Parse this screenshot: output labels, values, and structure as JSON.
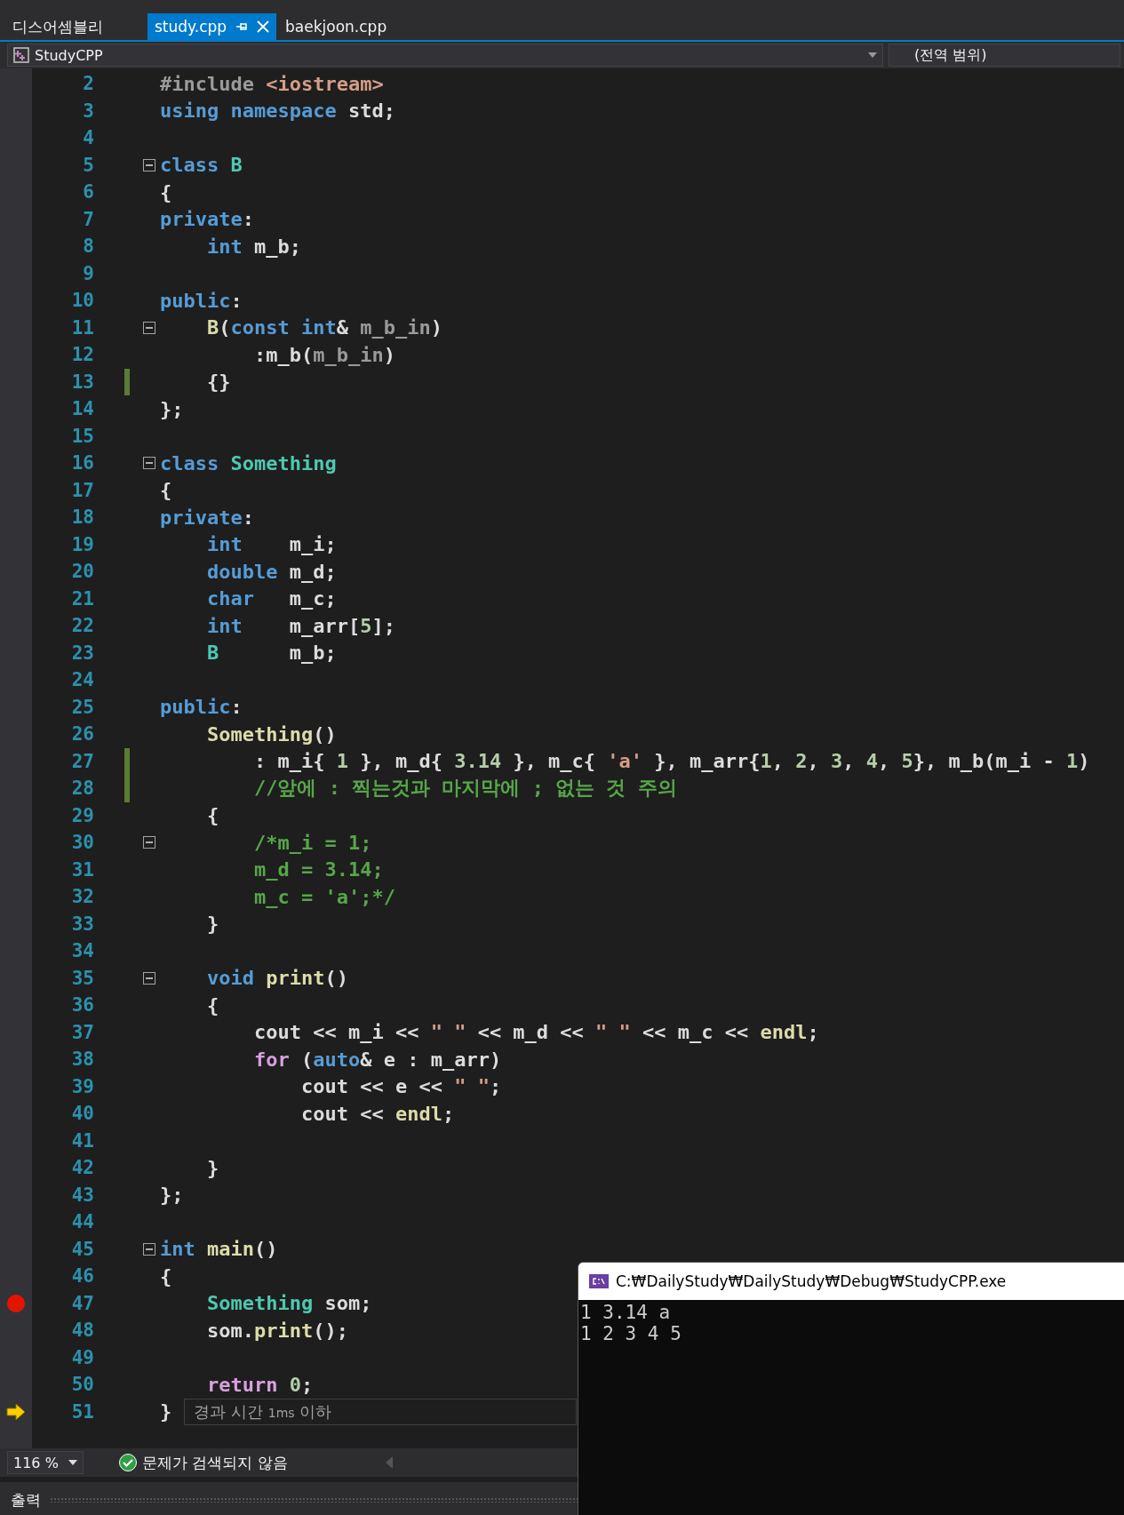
{
  "tabs": [
    {
      "label": "디스어셈블리",
      "selected": false
    },
    {
      "label": "study.cpp",
      "selected": true
    },
    {
      "label": "baekjoon.cpp",
      "selected": false
    }
  ],
  "navigation_bar": {
    "project": "StudyCPP",
    "scope": "(전역 범위)"
  },
  "editor": {
    "lines": [
      {
        "number": "2",
        "tokens": [
          {
            "kind": "macro",
            "text": "#include "
          },
          {
            "kind": "string",
            "text": "<iostream>"
          }
        ]
      },
      {
        "number": "3",
        "tokens": [
          {
            "kind": "keyword",
            "text": "using namespace"
          },
          {
            "kind": "plain",
            "text": " std;"
          }
        ]
      },
      {
        "number": "4"
      },
      {
        "number": "5",
        "foldable": true,
        "tokens": [
          {
            "kind": "keyword",
            "text": "class "
          },
          {
            "kind": "type",
            "text": "B"
          }
        ]
      },
      {
        "number": "6",
        "tokens": [
          {
            "kind": "plain",
            "text": "{"
          }
        ]
      },
      {
        "number": "7",
        "tokens": [
          {
            "kind": "keyword",
            "text": "private"
          },
          {
            "kind": "plain",
            "text": ":"
          }
        ]
      },
      {
        "number": "8",
        "tokens": [
          {
            "kind": "keyword",
            "text": "    int"
          },
          {
            "kind": "plain",
            "text": " m_b;"
          }
        ]
      },
      {
        "number": "9"
      },
      {
        "number": "10",
        "tokens": [
          {
            "kind": "keyword",
            "text": "public"
          },
          {
            "kind": "plain",
            "text": ":"
          }
        ]
      },
      {
        "number": "11",
        "foldable": true,
        "tokens": [
          {
            "kind": "function",
            "text": "    B"
          },
          {
            "kind": "plain",
            "text": "("
          },
          {
            "kind": "keyword",
            "text": "const int"
          },
          {
            "kind": "plain",
            "text": "& "
          },
          {
            "kind": "parameter",
            "text": "m_b_in"
          },
          {
            "kind": "plain",
            "text": ")"
          }
        ]
      },
      {
        "number": "12",
        "tokens": [
          {
            "kind": "plain",
            "text": "        :m_b("
          },
          {
            "kind": "parameter",
            "text": "m_b_in"
          },
          {
            "kind": "plain",
            "text": ")"
          }
        ]
      },
      {
        "number": "13",
        "changed": true,
        "tokens": [
          {
            "kind": "plain",
            "text": "    {}"
          }
        ]
      },
      {
        "number": "14",
        "tokens": [
          {
            "kind": "plain",
            "text": "};"
          }
        ]
      },
      {
        "number": "15"
      },
      {
        "number": "16",
        "foldable": true,
        "tokens": [
          {
            "kind": "keyword",
            "text": "class "
          },
          {
            "kind": "type",
            "text": "Something"
          }
        ]
      },
      {
        "number": "17",
        "tokens": [
          {
            "kind": "plain",
            "text": "{"
          }
        ]
      },
      {
        "number": "18",
        "tokens": [
          {
            "kind": "keyword",
            "text": "private"
          },
          {
            "kind": "plain",
            "text": ":"
          }
        ]
      },
      {
        "number": "19",
        "tokens": [
          {
            "kind": "keyword",
            "text": "    int"
          },
          {
            "kind": "plain",
            "text": "    m_i;"
          }
        ]
      },
      {
        "number": "20",
        "tokens": [
          {
            "kind": "keyword",
            "text": "    double"
          },
          {
            "kind": "plain",
            "text": " m_d;"
          }
        ]
      },
      {
        "number": "21",
        "tokens": [
          {
            "kind": "keyword",
            "text": "    char"
          },
          {
            "kind": "plain",
            "text": "   m_c;"
          }
        ]
      },
      {
        "number": "22",
        "tokens": [
          {
            "kind": "keyword",
            "text": "    int"
          },
          {
            "kind": "plain",
            "text": "    m_arr["
          },
          {
            "kind": "number",
            "text": "5"
          },
          {
            "kind": "plain",
            "text": "];"
          }
        ]
      },
      {
        "number": "23",
        "tokens": [
          {
            "kind": "type",
            "text": "    B"
          },
          {
            "kind": "plain",
            "text": "      m_b;"
          }
        ]
      },
      {
        "number": "24"
      },
      {
        "number": "25",
        "tokens": [
          {
            "kind": "keyword",
            "text": "public"
          },
          {
            "kind": "plain",
            "text": ":"
          }
        ]
      },
      {
        "number": "26",
        "tokens": [
          {
            "kind": "function",
            "text": "    Something"
          },
          {
            "kind": "plain",
            "text": "()"
          }
        ]
      },
      {
        "number": "27",
        "changed": true,
        "tokens": [
          {
            "kind": "plain",
            "text": "        : m_i{ "
          },
          {
            "kind": "number",
            "text": "1"
          },
          {
            "kind": "plain",
            "text": " }, m_d{ "
          },
          {
            "kind": "number",
            "text": "3.14"
          },
          {
            "kind": "plain",
            "text": " }, m_c{ "
          },
          {
            "kind": "string",
            "text": "'a'"
          },
          {
            "kind": "plain",
            "text": " }, m_arr{"
          },
          {
            "kind": "number",
            "text": "1"
          },
          {
            "kind": "plain",
            "text": ", "
          },
          {
            "kind": "number",
            "text": "2"
          },
          {
            "kind": "plain",
            "text": ", "
          },
          {
            "kind": "number",
            "text": "3"
          },
          {
            "kind": "plain",
            "text": ", "
          },
          {
            "kind": "number",
            "text": "4"
          },
          {
            "kind": "plain",
            "text": ", "
          },
          {
            "kind": "number",
            "text": "5"
          },
          {
            "kind": "plain",
            "text": "}, m_b(m_i - "
          },
          {
            "kind": "number",
            "text": "1"
          },
          {
            "kind": "plain",
            "text": ")"
          }
        ]
      },
      {
        "number": "28",
        "changed": true,
        "tokens": [
          {
            "kind": "comment",
            "text": "        //앞에 : 찍는것과 마지막에 ; 없는 것 주의"
          }
        ]
      },
      {
        "number": "29",
        "tokens": [
          {
            "kind": "plain",
            "text": "    {"
          }
        ]
      },
      {
        "number": "30",
        "foldable": true,
        "tokens": [
          {
            "kind": "comment",
            "text": "        /*m_i = 1;"
          }
        ]
      },
      {
        "number": "31",
        "tokens": [
          {
            "kind": "comment",
            "text": "        m_d = 3.14;"
          }
        ]
      },
      {
        "number": "32",
        "tokens": [
          {
            "kind": "comment",
            "text": "        m_c = 'a';*/"
          }
        ]
      },
      {
        "number": "33",
        "tokens": [
          {
            "kind": "plain",
            "text": "    }"
          }
        ]
      },
      {
        "number": "34"
      },
      {
        "number": "35",
        "foldable": true,
        "tokens": [
          {
            "kind": "keyword",
            "text": "    void "
          },
          {
            "kind": "function",
            "text": "print"
          },
          {
            "kind": "plain",
            "text": "()"
          }
        ]
      },
      {
        "number": "36",
        "tokens": [
          {
            "kind": "plain",
            "text": "    {"
          }
        ]
      },
      {
        "number": "37",
        "tokens": [
          {
            "kind": "plain",
            "text": "        cout << m_i << "
          },
          {
            "kind": "string",
            "text": "\" \""
          },
          {
            "kind": "plain",
            "text": " << m_d << "
          },
          {
            "kind": "string",
            "text": "\" \""
          },
          {
            "kind": "plain",
            "text": " << m_c << "
          },
          {
            "kind": "function",
            "text": "endl"
          },
          {
            "kind": "plain",
            "text": ";"
          }
        ]
      },
      {
        "number": "38",
        "tokens": [
          {
            "kind": "control",
            "text": "        for"
          },
          {
            "kind": "plain",
            "text": " ("
          },
          {
            "kind": "keyword",
            "text": "auto"
          },
          {
            "kind": "plain",
            "text": "& e : m_arr)"
          }
        ]
      },
      {
        "number": "39",
        "tokens": [
          {
            "kind": "plain",
            "text": "            cout << e << "
          },
          {
            "kind": "string",
            "text": "\" \""
          },
          {
            "kind": "plain",
            "text": ";"
          }
        ]
      },
      {
        "number": "40",
        "tokens": [
          {
            "kind": "plain",
            "text": "            cout << "
          },
          {
            "kind": "function",
            "text": "endl"
          },
          {
            "kind": "plain",
            "text": ";"
          }
        ]
      },
      {
        "number": "41"
      },
      {
        "number": "42",
        "tokens": [
          {
            "kind": "plain",
            "text": "    }"
          }
        ]
      },
      {
        "number": "43",
        "tokens": [
          {
            "kind": "plain",
            "text": "};"
          }
        ]
      },
      {
        "number": "44"
      },
      {
        "number": "45",
        "foldable": true,
        "tokens": [
          {
            "kind": "keyword",
            "text": "int "
          },
          {
            "kind": "function",
            "text": "main"
          },
          {
            "kind": "plain",
            "text": "()"
          }
        ]
      },
      {
        "number": "46",
        "tokens": [
          {
            "kind": "plain",
            "text": "{"
          }
        ]
      },
      {
        "number": "47",
        "breakpoint": true,
        "tokens": [
          {
            "kind": "type",
            "text": "    Something"
          },
          {
            "kind": "plain",
            "text": " som;"
          }
        ]
      },
      {
        "number": "48",
        "tokens": [
          {
            "kind": "plain",
            "text": "    som."
          },
          {
            "kind": "function",
            "text": "print"
          },
          {
            "kind": "plain",
            "text": "();"
          }
        ]
      },
      {
        "number": "49"
      },
      {
        "number": "50",
        "tokens": [
          {
            "kind": "control",
            "text": "    return "
          },
          {
            "kind": "number",
            "text": "0"
          },
          {
            "kind": "plain",
            "text": ";"
          }
        ]
      },
      {
        "number": "51",
        "current": true,
        "tokens": [
          {
            "kind": "plain",
            "text": "}"
          }
        ],
        "hint": {
          "label": "경과 시간",
          "value": "1ms",
          "suffix": "이하"
        }
      }
    ]
  },
  "status_bar": {
    "zoom": "116 %",
    "issues": "문제가 검색되지 않음"
  },
  "output_panel": {
    "title": "출력"
  },
  "console_window": {
    "title": "C:₩DailyStudy₩DailyStudy₩Debug₩StudyCPP.exe",
    "lines": [
      "1 3.14 a",
      "1 2 3 4 5"
    ]
  }
}
